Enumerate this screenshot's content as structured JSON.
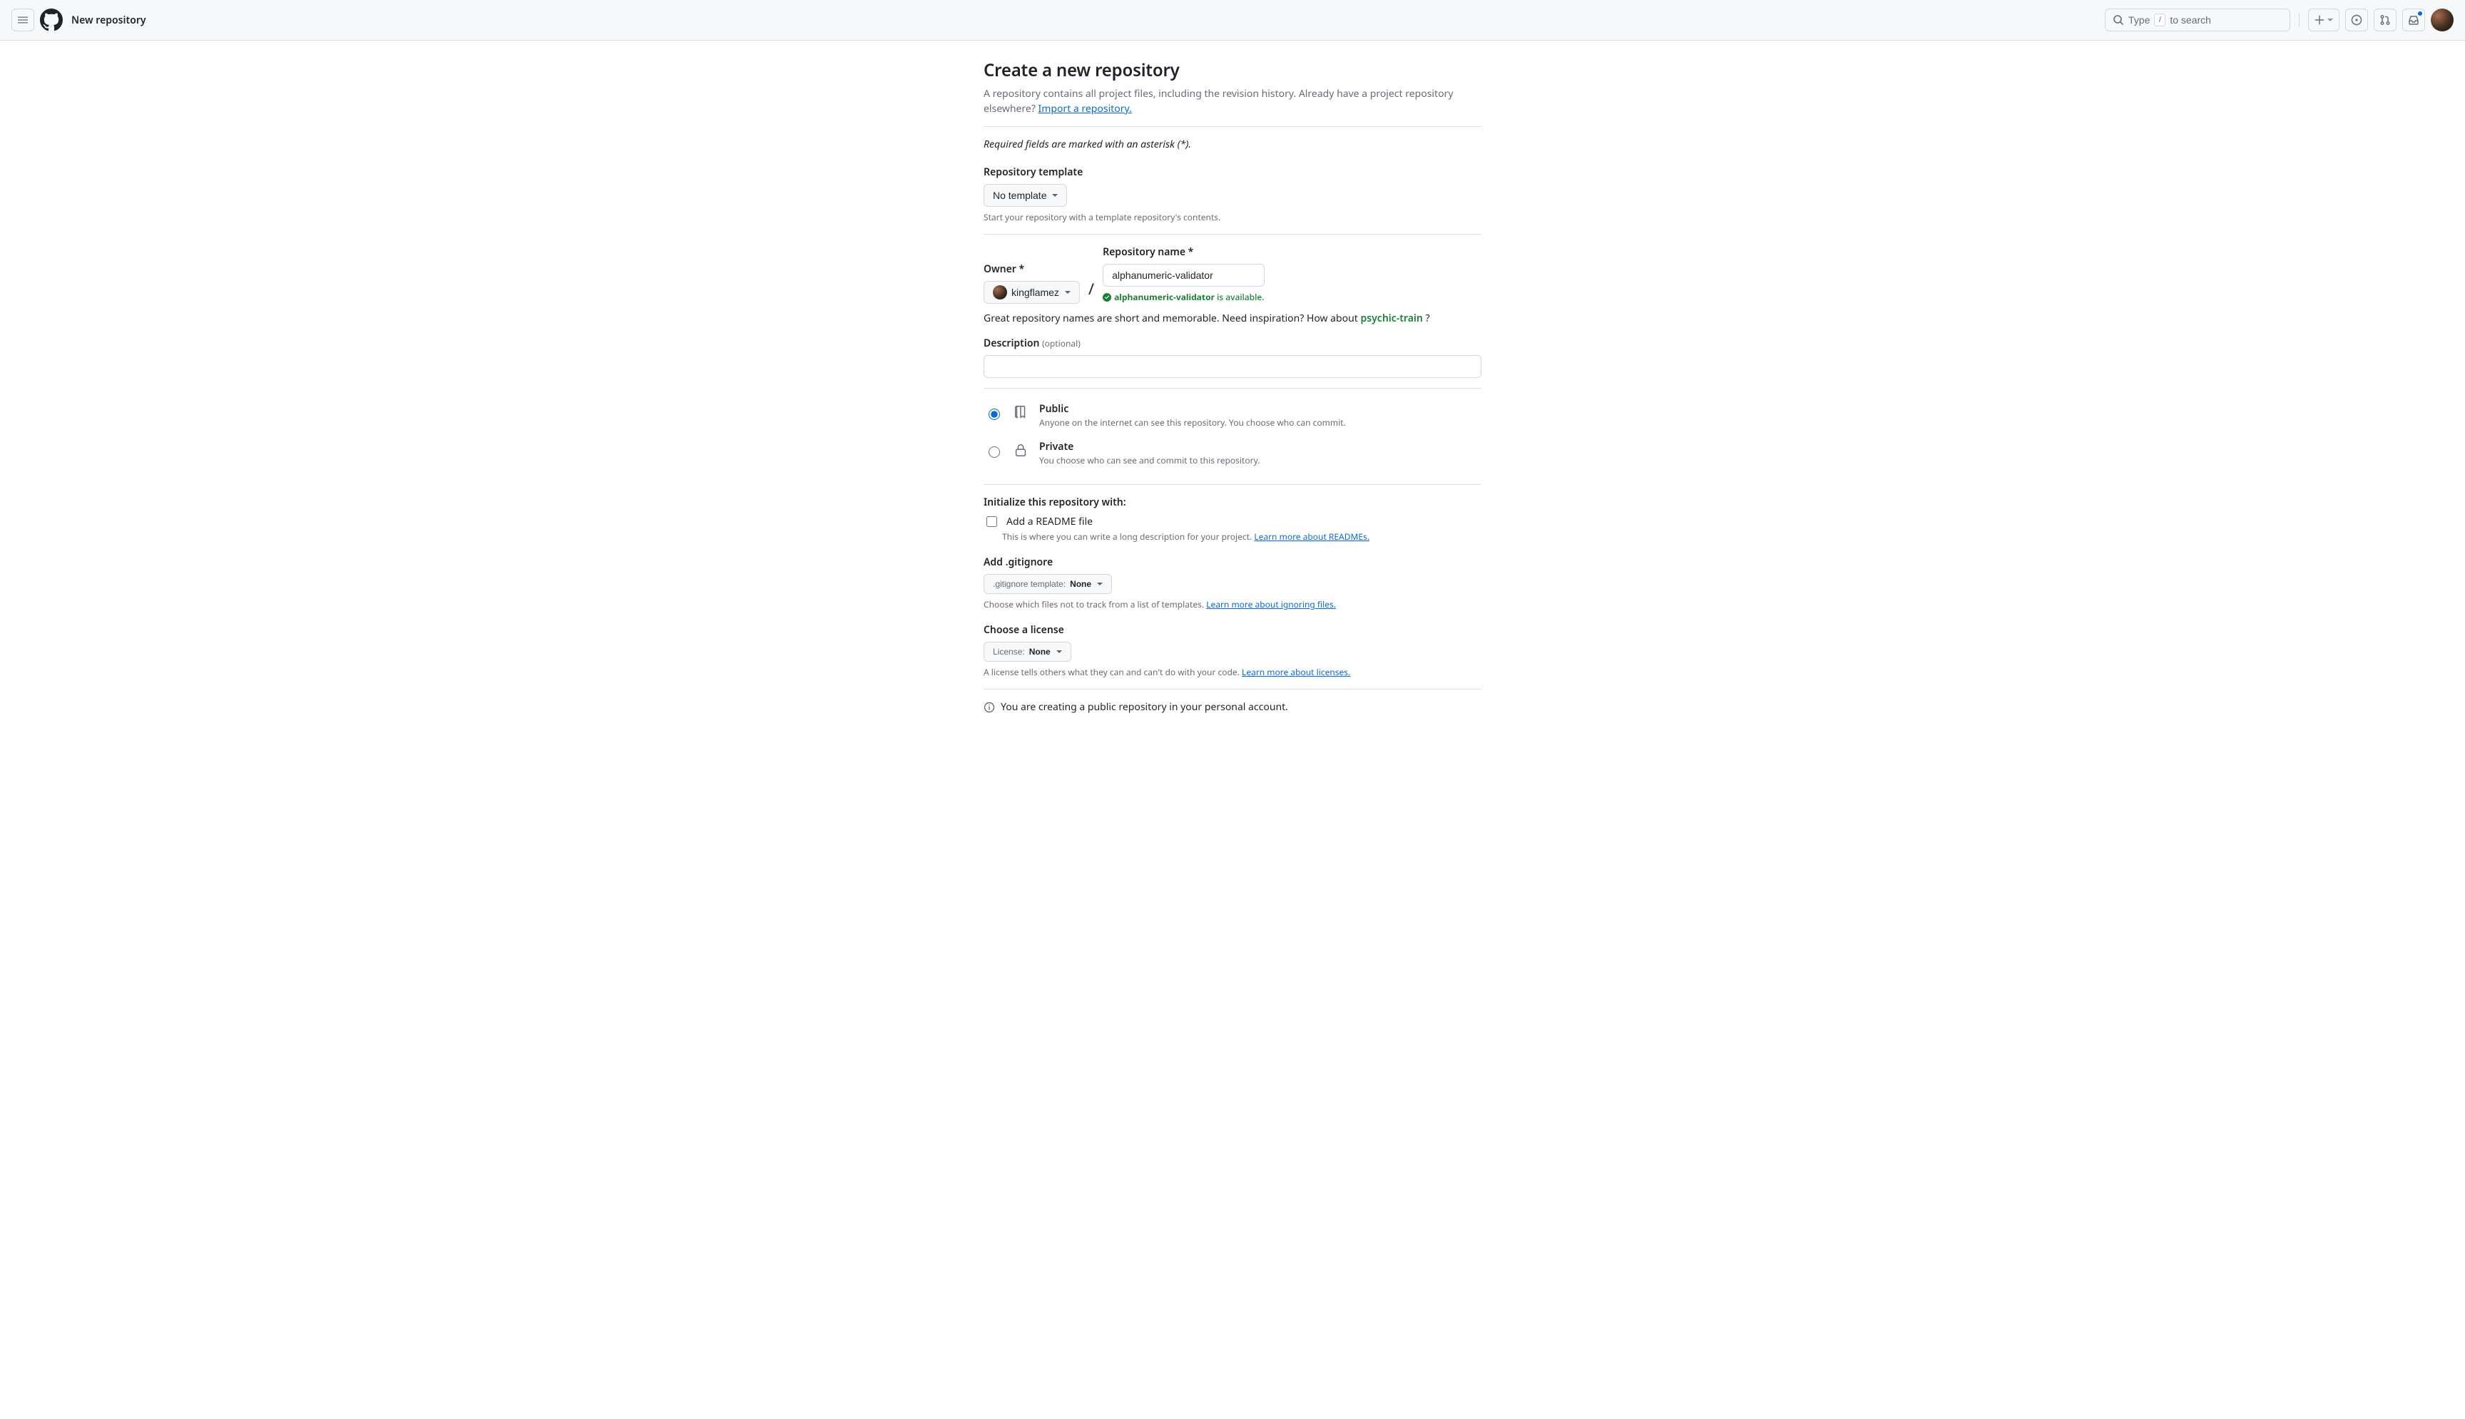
{
  "header": {
    "title": "New repository",
    "search_prefix": "Type",
    "search_key": "/",
    "search_suffix": "to search"
  },
  "page": {
    "heading": "Create a new repository",
    "description_p1": "A repository contains all project files, including the revision history. Already have a project repository elsewhere? ",
    "import_link": "Import a repository.",
    "required_note": "Required fields are marked with an asterisk (*).",
    "template": {
      "label": "Repository template",
      "selected": "No template",
      "hint": "Start your repository with a template repository's contents."
    },
    "owner": {
      "label": "Owner *",
      "selected": "kingflamez"
    },
    "repo_name": {
      "label": "Repository name *",
      "value": "alphanumeric-validator",
      "available_prefix": "alphanumeric-validator",
      "available_suffix": " is available."
    },
    "suggest": {
      "prefix": "Great repository names are short and memorable. Need inspiration? How about ",
      "name": "psychic-train",
      "suffix": " ?"
    },
    "description": {
      "label": "Description",
      "optional": "(optional)",
      "value": ""
    },
    "visibility": {
      "public": {
        "title": "Public",
        "desc": "Anyone on the internet can see this repository. You choose who can commit."
      },
      "private": {
        "title": "Private",
        "desc": "You choose who can see and commit to this repository."
      }
    },
    "init": {
      "heading": "Initialize this repository with:",
      "readme": {
        "label": "Add a README file",
        "desc": "This is where you can write a long description for your project. ",
        "link": "Learn more about READMEs."
      },
      "gitignore": {
        "label": "Add .gitignore",
        "btn_prefix": ".gitignore template: ",
        "btn_value": "None",
        "desc": "Choose which files not to track from a list of templates. ",
        "link": "Learn more about ignoring files."
      },
      "license": {
        "label": "Choose a license",
        "btn_prefix": "License: ",
        "btn_value": "None",
        "desc": "A license tells others what they can and can't do with your code. ",
        "link": "Learn more about licenses."
      }
    },
    "info_line": "You are creating a public repository in your personal account."
  }
}
